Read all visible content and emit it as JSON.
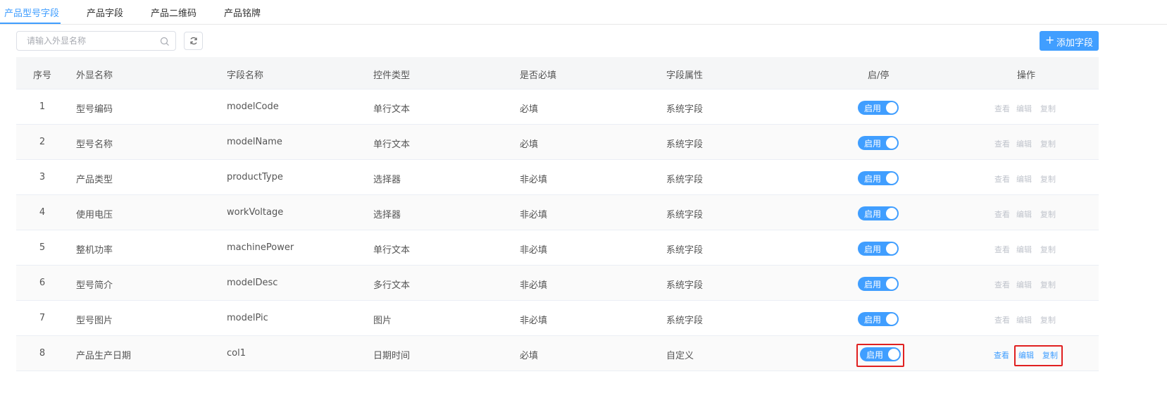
{
  "tabs": [
    {
      "label": "产品型号字段",
      "active": true
    },
    {
      "label": "产品字段",
      "active": false
    },
    {
      "label": "产品二维码",
      "active": false
    },
    {
      "label": "产品铭牌",
      "active": false
    }
  ],
  "search": {
    "placeholder": "请输入外显名称",
    "value": ""
  },
  "toolbar": {
    "add_label": "添加字段",
    "add_icon": "plus-icon",
    "refresh_icon": "refresh-icon",
    "search_icon": "search-icon"
  },
  "table": {
    "headers": [
      "序号",
      "外显名称",
      "字段名称",
      "控件类型",
      "是否必填",
      "字段属性",
      "启/停",
      "操作"
    ],
    "rows": [
      {
        "index": "1",
        "display_name": "型号编码",
        "field_name": "modelCode",
        "control_type": "单行文本",
        "required": "必填",
        "attribute": "系统字段",
        "status": "启用",
        "actions": [
          "查看",
          "编辑",
          "复制"
        ],
        "actions_enabled": false
      },
      {
        "index": "2",
        "display_name": "型号名称",
        "field_name": "modelName",
        "control_type": "单行文本",
        "required": "必填",
        "attribute": "系统字段",
        "status": "启用",
        "actions": [
          "查看",
          "编辑",
          "复制"
        ],
        "actions_enabled": false
      },
      {
        "index": "3",
        "display_name": "产品类型",
        "field_name": "productType",
        "control_type": "选择器",
        "required": "非必填",
        "attribute": "系统字段",
        "status": "启用",
        "actions": [
          "查看",
          "编辑",
          "复制"
        ],
        "actions_enabled": false
      },
      {
        "index": "4",
        "display_name": "使用电压",
        "field_name": "workVoltage",
        "control_type": "选择器",
        "required": "非必填",
        "attribute": "系统字段",
        "status": "启用",
        "actions": [
          "查看",
          "编辑",
          "复制"
        ],
        "actions_enabled": false
      },
      {
        "index": "5",
        "display_name": "整机功率",
        "field_name": "machinePower",
        "control_type": "单行文本",
        "required": "非必填",
        "attribute": "系统字段",
        "status": "启用",
        "actions": [
          "查看",
          "编辑",
          "复制"
        ],
        "actions_enabled": false
      },
      {
        "index": "6",
        "display_name": "型号简介",
        "field_name": "modelDesc",
        "control_type": "多行文本",
        "required": "非必填",
        "attribute": "系统字段",
        "status": "启用",
        "actions": [
          "查看",
          "编辑",
          "复制"
        ],
        "actions_enabled": false
      },
      {
        "index": "7",
        "display_name": "型号图片",
        "field_name": "modelPic",
        "control_type": "图片",
        "required": "非必填",
        "attribute": "系统字段",
        "status": "启用",
        "actions": [
          "查看",
          "编辑",
          "复制"
        ],
        "actions_enabled": false
      },
      {
        "index": "8",
        "display_name": "产品生产日期",
        "field_name": "col1",
        "control_type": "日期时间",
        "required": "必填",
        "attribute": "自定义",
        "status": "启用",
        "actions": [
          "查看",
          "编辑",
          "复制"
        ],
        "actions_enabled": true
      }
    ]
  },
  "colors": {
    "accent": "#409eff",
    "highlight": "#e02020",
    "disabled": "#c0c4cc"
  }
}
